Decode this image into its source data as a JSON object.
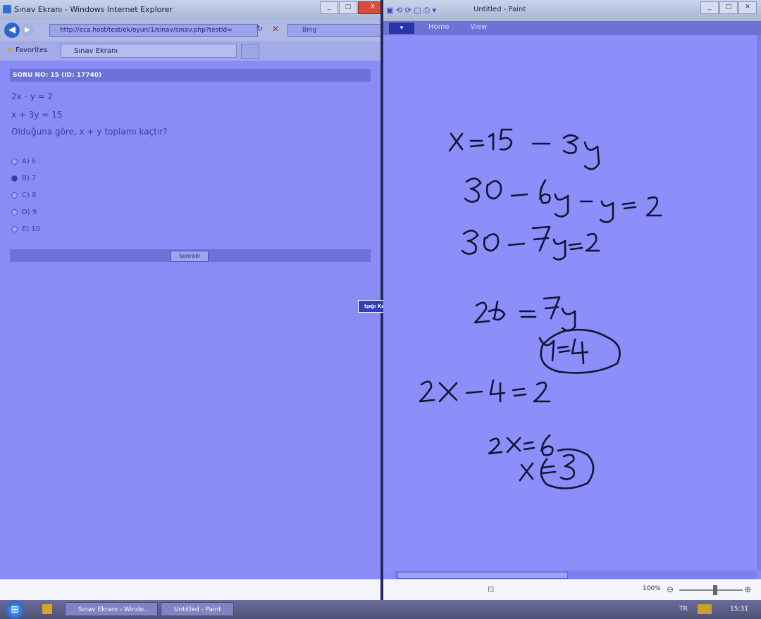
{
  "ie": {
    "title": "Sınav Ekranı - Windows Internet Explorer",
    "url": "http://eca.host/test/ek/oyun/1/sinav/sinav.php?testid=",
    "search_placeholder": "Bing",
    "favorites_label": "Favorites",
    "tab_label": "Sınav Ekranı",
    "win_buttons": [
      "_",
      "□",
      "X"
    ]
  },
  "question": {
    "header": "SORU NO: 15 (ID: 17740)",
    "lines": [
      "2x - y = 2",
      "x + 3y = 15",
      "Olduğuna göre, x + y toplamı kaçtır?"
    ],
    "options": [
      {
        "label": "A) 6",
        "selected": false
      },
      {
        "label": "B) 7",
        "selected": true
      },
      {
        "label": "C) 8",
        "selected": false
      },
      {
        "label": "D) 9",
        "selected": false
      },
      {
        "label": "E) 10",
        "selected": false
      }
    ],
    "next_label": "Sonraki"
  },
  "floating_label": "Işığı Kapat",
  "paint": {
    "title": "Untitled - Paint",
    "menu_label": "▾",
    "tabs": [
      "Home",
      "View"
    ],
    "zoom": "100%",
    "status_icon": "⊡",
    "handwriting": [
      "x = 15 - 3y",
      "30 - 6y - y = 2",
      "30 - 7y = 2",
      "28 = 7y",
      "y = 4",
      "2x - 4 = 2",
      "2x = 6",
      "x = 3"
    ]
  },
  "taskbar": {
    "items": [
      {
        "label": "Sınav Ekranı - Windo..."
      },
      {
        "label": "Untitled - Paint"
      }
    ],
    "lang": "TR",
    "time": "15:31"
  },
  "colors": {
    "overlay": "#8a8cf6",
    "accent": "#6d72d6",
    "ink": "#111433"
  }
}
